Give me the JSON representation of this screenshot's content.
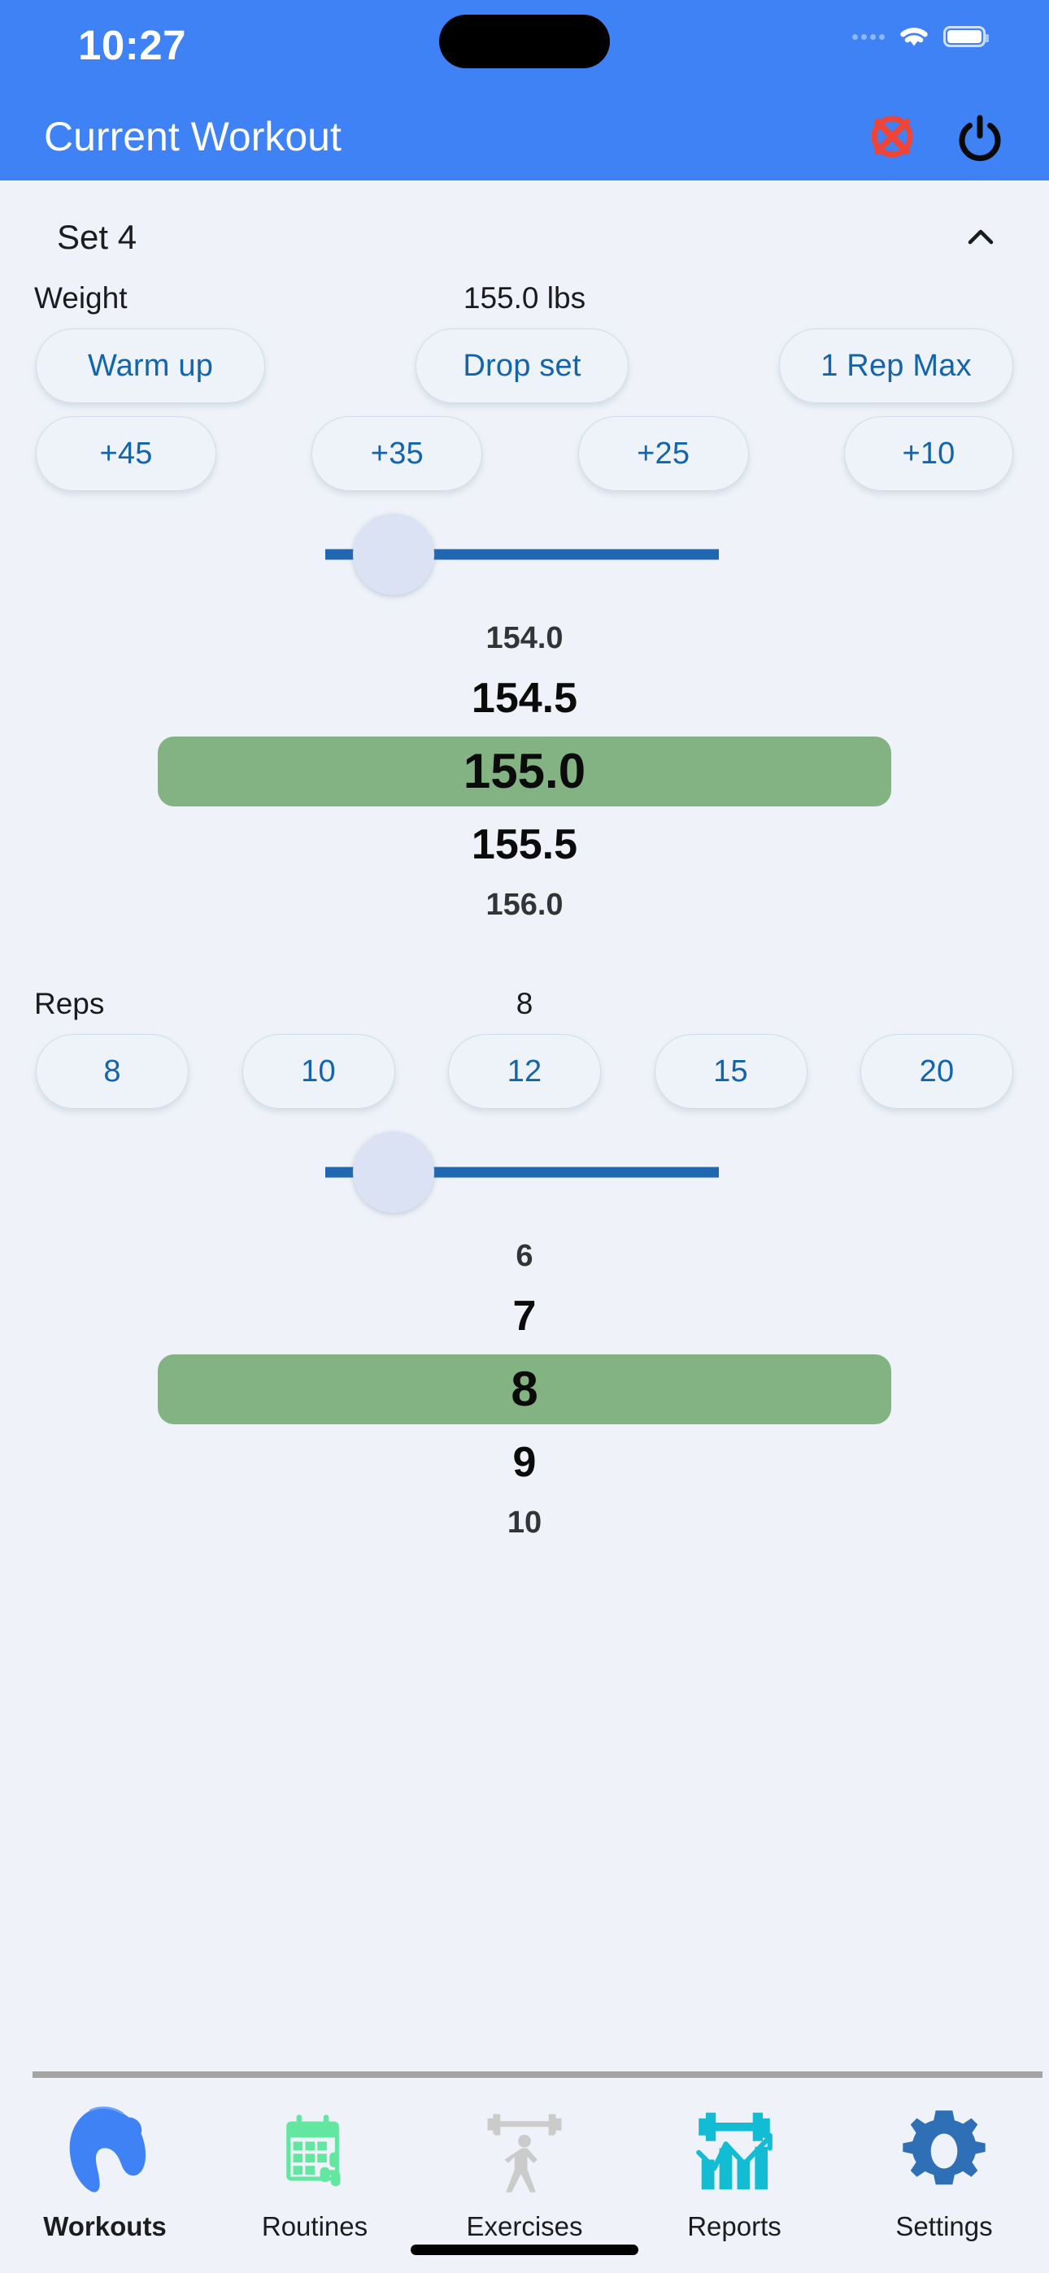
{
  "status_bar": {
    "time": "10:27",
    "cellular_icon": "cellular-dots-icon",
    "wifi_icon": "wifi-icon",
    "battery_icon": "battery-full-icon"
  },
  "nav_bar": {
    "title": "Current Workout",
    "cancel_icon": "cancel-circle-x-icon",
    "cancel_color": "#ef4436",
    "power_icon": "power-icon",
    "power_color": "#0a0a0a",
    "background": "#3f82f5"
  },
  "set_panel": {
    "title": "Set 4",
    "collapse_icon": "chevron-up-icon"
  },
  "weight": {
    "label": "Weight",
    "value_display": "155.0 lbs",
    "value": 155.0,
    "unit": "lbs",
    "modifier_buttons": [
      "Warm up",
      "Drop set",
      "1 Rep Max"
    ],
    "increment_buttons": [
      "+45",
      "+35",
      "+25",
      "+10"
    ],
    "slider": {
      "min_label": "",
      "max_label": "",
      "fill_color": "#1f67b1",
      "thumb_color": "#dbe2f3"
    },
    "picker": {
      "options": [
        "154.0",
        "154.5",
        "155.0",
        "155.5",
        "156.0"
      ],
      "selected_index": 2,
      "selected": "155.0",
      "highlight_color": "#83b283"
    }
  },
  "reps": {
    "label": "Reps",
    "value_display": "8",
    "value": 8,
    "quick_buttons": [
      "8",
      "10",
      "12",
      "15",
      "20"
    ],
    "slider": {
      "fill_color": "#1f67b1",
      "thumb_color": "#dbe2f3"
    },
    "picker": {
      "options": [
        "6",
        "7",
        "8",
        "9",
        "10"
      ],
      "selected_index": 2,
      "selected": "8",
      "highlight_color": "#83b283"
    }
  },
  "tab_bar": {
    "active_index": 0,
    "tabs": [
      {
        "label": "Workouts",
        "icon": "bicep-flex-icon",
        "color": "#3f82f5"
      },
      {
        "label": "Routines",
        "icon": "calendar-clock-icon",
        "color": "#62e6a0"
      },
      {
        "label": "Exercises",
        "icon": "weightlifter-icon",
        "color": "#cbcbcb"
      },
      {
        "label": "Reports",
        "icon": "chart-dumbbell-icon",
        "color": "#12bdd4"
      },
      {
        "label": "Settings",
        "icon": "gear-icon",
        "color": "#2f6fb5"
      }
    ]
  },
  "theme": {
    "accent": "#3f82f5",
    "page_background": "#eff3f9",
    "pill_text": "#1464ab",
    "picker_highlight": "#83b283"
  }
}
